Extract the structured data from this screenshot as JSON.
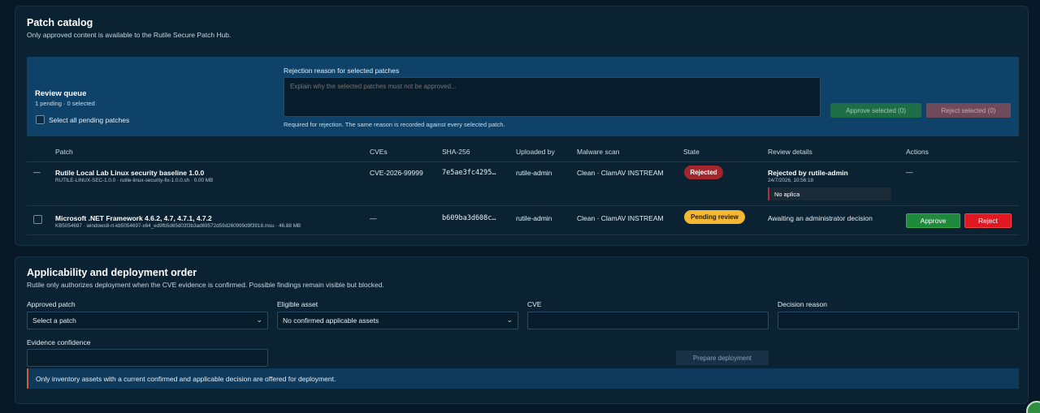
{
  "catalog": {
    "title": "Patch catalog",
    "subtitle": "Only approved content is available to the Rutile Secure Patch Hub.",
    "review": {
      "title": "Review queue",
      "count": "1 pending · 0 selected",
      "select_all_label": "Select all pending patches",
      "reason_label": "Rejection reason for selected patches",
      "reason_placeholder": "Explain why the selected patches must not be approved...",
      "reason_help": "Required for rejection. The same reason is recorded against every selected patch.",
      "approve_selected": "Approve selected (0)",
      "reject_selected": "Reject selected (0)"
    },
    "columns": [
      "Patch",
      "CVEs",
      "SHA-256",
      "Uploaded by",
      "Malware scan",
      "State",
      "Review details",
      "Actions"
    ],
    "rows": [
      {
        "marker": "—",
        "name": "Rutile Local Lab Linux security baseline 1.0.0",
        "meta": "RUTILE-LINUX-SEC-1.0.0 · rutile-linux-security-fix-1.0.0.sh · 0.00 MB",
        "cves": "CVE-2026-99999",
        "sha": "7e5ae3fc4295…",
        "uploaded_by": "rutile-admin",
        "scan": "Clean · ClamAV INSTREAM",
        "state": "Rejected",
        "review_title": "Rejected by rutile-admin",
        "review_time": "24/7/2026, 10:56:18",
        "review_note": "No aplica",
        "actions": "—"
      },
      {
        "name": "Microsoft .NET Framework 4.6.2, 4.7, 4.7.1, 4.7.2",
        "meta": "KB5054697 · windows8-rt-kb5054697-x64_ed9fb5d65d03f3b3ad69572d59d260999d9f3918.msu · 46.88 MB",
        "cves": "—",
        "sha": "b609ba3d608c…",
        "uploaded_by": "rutile-admin",
        "scan": "Clean · ClamAV INSTREAM",
        "state": "Pending review",
        "review_text": "Awaiting an administrator decision",
        "approve": "Approve",
        "reject": "Reject"
      }
    ]
  },
  "deploy": {
    "title": "Applicability and deployment order",
    "subtitle": "Rutile only authorizes deployment when the CVE evidence is confirmed. Possible findings remain visible but blocked.",
    "approved_patch_label": "Approved patch",
    "approved_patch_value": "Select a patch",
    "eligible_asset_label": "Eligible asset",
    "eligible_asset_value": "No confirmed applicable assets",
    "cve_label": "CVE",
    "decision_reason_label": "Decision reason",
    "evidence_label": "Evidence confidence",
    "prepare_button": "Prepare deployment",
    "info": "Only inventory assets with a current confirmed and applicable decision are offered for deployment."
  },
  "colors": {
    "background": "#071826",
    "panel": "#0a2232",
    "review_bar": "#0f4268",
    "rejected": "#a3262d",
    "pending": "#f2b733",
    "approve": "#1f8a3b",
    "reject": "#e01822"
  },
  "icons": {
    "select_chevron": "chevron-down-icon",
    "corner": "app-status-icon"
  }
}
